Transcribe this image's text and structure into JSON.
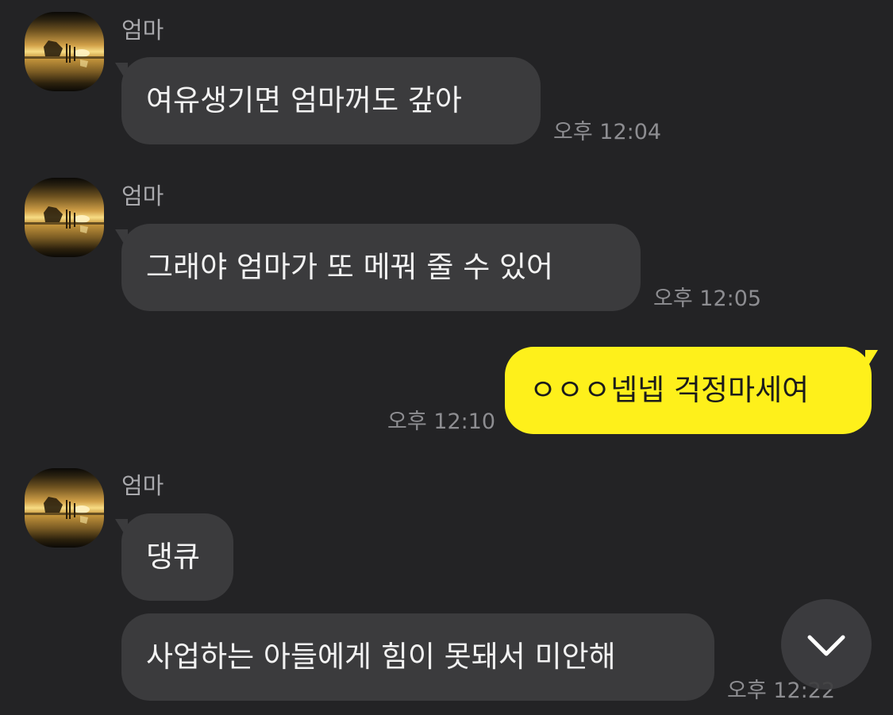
{
  "messages": [
    {
      "sender": "엄마",
      "text": "여유생기면  엄마꺼도 갚아",
      "time": "오후 12:04"
    },
    {
      "sender": "엄마",
      "text": "그래야  엄마가 또 메꿔 줄 수 있어",
      "time": "오후 12:05"
    },
    {
      "text": "ㅇㅇㅇ넵넵 걱정마세여",
      "time": "오후 12:10"
    },
    {
      "sender": "엄마",
      "text": "댕큐"
    },
    {
      "text": "사업하는 아들에게  힘이 못돼서 미안해",
      "time": "오후 12:22"
    }
  ],
  "colors": {
    "background": "#232325",
    "incoming_bubble": "#3b3b3d",
    "outgoing_bubble": "#fef01b"
  },
  "icons": {
    "avatar": "sunset-photo",
    "scroll_down": "chevron-down-icon"
  }
}
